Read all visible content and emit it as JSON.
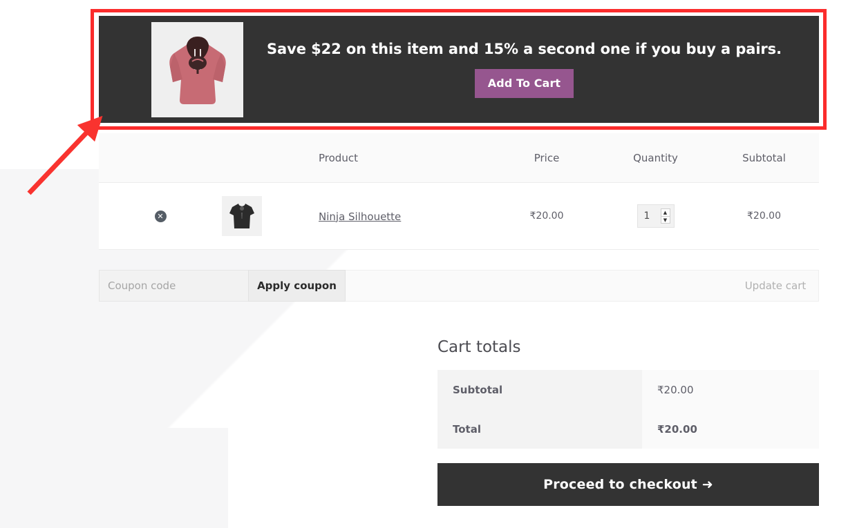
{
  "promo": {
    "text": "Save $22 on this item and 15% a second one if you buy a pairs.",
    "button_label": "Add To Cart",
    "thumb_alt": "pink-hoodie-product-image",
    "background_color": "#333333",
    "button_color": "#96568f"
  },
  "annotation": {
    "box_color": "#fb2c2c",
    "arrow_color": "#f9332f"
  },
  "cart_table": {
    "headers": {
      "remove": "",
      "thumb": "",
      "product": "Product",
      "price": "Price",
      "quantity": "Quantity",
      "subtotal": "Subtotal"
    },
    "rows": [
      {
        "remove_icon": "remove-item-icon",
        "thumb_alt": "black-tshirt-thumbnail",
        "product": "Ninja Silhouette",
        "price": "₹20.00",
        "quantity": "1",
        "subtotal": "₹20.00"
      }
    ]
  },
  "coupon": {
    "placeholder": "Coupon code",
    "value": "",
    "apply_label": "Apply coupon",
    "update_label": "Update cart"
  },
  "totals": {
    "title": "Cart totals",
    "rows": [
      {
        "label": "Subtotal",
        "value": "₹20.00"
      },
      {
        "label": "Total",
        "value": "₹20.00"
      }
    ],
    "checkout_label": "Proceed to checkout",
    "checkout_arrow": "➜"
  }
}
